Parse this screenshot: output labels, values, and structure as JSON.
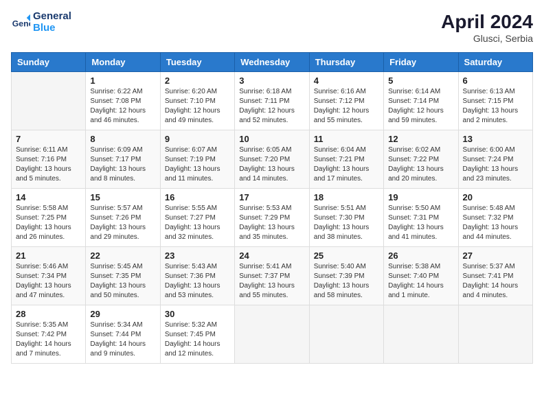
{
  "header": {
    "logo_line1": "General",
    "logo_line2": "Blue",
    "month_year": "April 2024",
    "location": "Glusci, Serbia"
  },
  "weekdays": [
    "Sunday",
    "Monday",
    "Tuesday",
    "Wednesday",
    "Thursday",
    "Friday",
    "Saturday"
  ],
  "weeks": [
    [
      {
        "day": "",
        "sunrise": "",
        "sunset": "",
        "daylight": ""
      },
      {
        "day": "1",
        "sunrise": "Sunrise: 6:22 AM",
        "sunset": "Sunset: 7:08 PM",
        "daylight": "Daylight: 12 hours and 46 minutes."
      },
      {
        "day": "2",
        "sunrise": "Sunrise: 6:20 AM",
        "sunset": "Sunset: 7:10 PM",
        "daylight": "Daylight: 12 hours and 49 minutes."
      },
      {
        "day": "3",
        "sunrise": "Sunrise: 6:18 AM",
        "sunset": "Sunset: 7:11 PM",
        "daylight": "Daylight: 12 hours and 52 minutes."
      },
      {
        "day": "4",
        "sunrise": "Sunrise: 6:16 AM",
        "sunset": "Sunset: 7:12 PM",
        "daylight": "Daylight: 12 hours and 55 minutes."
      },
      {
        "day": "5",
        "sunrise": "Sunrise: 6:14 AM",
        "sunset": "Sunset: 7:14 PM",
        "daylight": "Daylight: 12 hours and 59 minutes."
      },
      {
        "day": "6",
        "sunrise": "Sunrise: 6:13 AM",
        "sunset": "Sunset: 7:15 PM",
        "daylight": "Daylight: 13 hours and 2 minutes."
      }
    ],
    [
      {
        "day": "7",
        "sunrise": "Sunrise: 6:11 AM",
        "sunset": "Sunset: 7:16 PM",
        "daylight": "Daylight: 13 hours and 5 minutes."
      },
      {
        "day": "8",
        "sunrise": "Sunrise: 6:09 AM",
        "sunset": "Sunset: 7:17 PM",
        "daylight": "Daylight: 13 hours and 8 minutes."
      },
      {
        "day": "9",
        "sunrise": "Sunrise: 6:07 AM",
        "sunset": "Sunset: 7:19 PM",
        "daylight": "Daylight: 13 hours and 11 minutes."
      },
      {
        "day": "10",
        "sunrise": "Sunrise: 6:05 AM",
        "sunset": "Sunset: 7:20 PM",
        "daylight": "Daylight: 13 hours and 14 minutes."
      },
      {
        "day": "11",
        "sunrise": "Sunrise: 6:04 AM",
        "sunset": "Sunset: 7:21 PM",
        "daylight": "Daylight: 13 hours and 17 minutes."
      },
      {
        "day": "12",
        "sunrise": "Sunrise: 6:02 AM",
        "sunset": "Sunset: 7:22 PM",
        "daylight": "Daylight: 13 hours and 20 minutes."
      },
      {
        "day": "13",
        "sunrise": "Sunrise: 6:00 AM",
        "sunset": "Sunset: 7:24 PM",
        "daylight": "Daylight: 13 hours and 23 minutes."
      }
    ],
    [
      {
        "day": "14",
        "sunrise": "Sunrise: 5:58 AM",
        "sunset": "Sunset: 7:25 PM",
        "daylight": "Daylight: 13 hours and 26 minutes."
      },
      {
        "day": "15",
        "sunrise": "Sunrise: 5:57 AM",
        "sunset": "Sunset: 7:26 PM",
        "daylight": "Daylight: 13 hours and 29 minutes."
      },
      {
        "day": "16",
        "sunrise": "Sunrise: 5:55 AM",
        "sunset": "Sunset: 7:27 PM",
        "daylight": "Daylight: 13 hours and 32 minutes."
      },
      {
        "day": "17",
        "sunrise": "Sunrise: 5:53 AM",
        "sunset": "Sunset: 7:29 PM",
        "daylight": "Daylight: 13 hours and 35 minutes."
      },
      {
        "day": "18",
        "sunrise": "Sunrise: 5:51 AM",
        "sunset": "Sunset: 7:30 PM",
        "daylight": "Daylight: 13 hours and 38 minutes."
      },
      {
        "day": "19",
        "sunrise": "Sunrise: 5:50 AM",
        "sunset": "Sunset: 7:31 PM",
        "daylight": "Daylight: 13 hours and 41 minutes."
      },
      {
        "day": "20",
        "sunrise": "Sunrise: 5:48 AM",
        "sunset": "Sunset: 7:32 PM",
        "daylight": "Daylight: 13 hours and 44 minutes."
      }
    ],
    [
      {
        "day": "21",
        "sunrise": "Sunrise: 5:46 AM",
        "sunset": "Sunset: 7:34 PM",
        "daylight": "Daylight: 13 hours and 47 minutes."
      },
      {
        "day": "22",
        "sunrise": "Sunrise: 5:45 AM",
        "sunset": "Sunset: 7:35 PM",
        "daylight": "Daylight: 13 hours and 50 minutes."
      },
      {
        "day": "23",
        "sunrise": "Sunrise: 5:43 AM",
        "sunset": "Sunset: 7:36 PM",
        "daylight": "Daylight: 13 hours and 53 minutes."
      },
      {
        "day": "24",
        "sunrise": "Sunrise: 5:41 AM",
        "sunset": "Sunset: 7:37 PM",
        "daylight": "Daylight: 13 hours and 55 minutes."
      },
      {
        "day": "25",
        "sunrise": "Sunrise: 5:40 AM",
        "sunset": "Sunset: 7:39 PM",
        "daylight": "Daylight: 13 hours and 58 minutes."
      },
      {
        "day": "26",
        "sunrise": "Sunrise: 5:38 AM",
        "sunset": "Sunset: 7:40 PM",
        "daylight": "Daylight: 14 hours and 1 minute."
      },
      {
        "day": "27",
        "sunrise": "Sunrise: 5:37 AM",
        "sunset": "Sunset: 7:41 PM",
        "daylight": "Daylight: 14 hours and 4 minutes."
      }
    ],
    [
      {
        "day": "28",
        "sunrise": "Sunrise: 5:35 AM",
        "sunset": "Sunset: 7:42 PM",
        "daylight": "Daylight: 14 hours and 7 minutes."
      },
      {
        "day": "29",
        "sunrise": "Sunrise: 5:34 AM",
        "sunset": "Sunset: 7:44 PM",
        "daylight": "Daylight: 14 hours and 9 minutes."
      },
      {
        "day": "30",
        "sunrise": "Sunrise: 5:32 AM",
        "sunset": "Sunset: 7:45 PM",
        "daylight": "Daylight: 14 hours and 12 minutes."
      },
      {
        "day": "",
        "sunrise": "",
        "sunset": "",
        "daylight": ""
      },
      {
        "day": "",
        "sunrise": "",
        "sunset": "",
        "daylight": ""
      },
      {
        "day": "",
        "sunrise": "",
        "sunset": "",
        "daylight": ""
      },
      {
        "day": "",
        "sunrise": "",
        "sunset": "",
        "daylight": ""
      }
    ]
  ]
}
